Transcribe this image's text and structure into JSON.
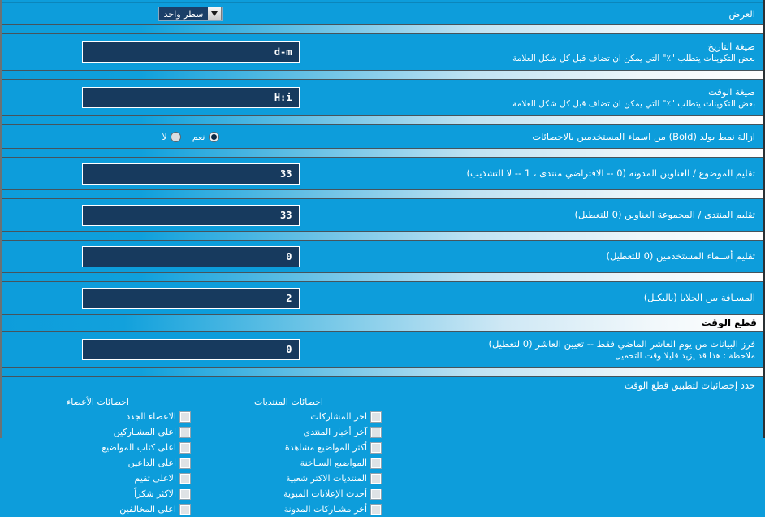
{
  "colors": {
    "background": "#0d9ddb",
    "input_bg": "#173a5e",
    "input_border": "#ffffff",
    "text": "#ffffff",
    "divider_light": "#ffffff",
    "header_text": "#000000"
  },
  "rows": {
    "display": {
      "label": "العرض",
      "select_value": "سطر واحد",
      "arrow_icon": "chevron-down-icon"
    },
    "date_format": {
      "label": "صيغة التاريخ",
      "sub": "بعض التكوينات يتطلب \"٪\" التي يمكن ان تضاف قبل كل شكل العلامة",
      "value": "d-m"
    },
    "time_format": {
      "label": "صيغة الوقت",
      "sub": "بعض التكوينات يتطلب \"٪\" التي يمكن ان تضاف قبل كل شكل العلامة",
      "value": "H:i"
    },
    "remove_bold": {
      "label": "ازالة نمط بولد (Bold) من اسماء المستخدمين بالاحصائات",
      "options": [
        {
          "label": "نعم",
          "selected": true
        },
        {
          "label": "لا",
          "selected": false
        }
      ]
    },
    "trim_topic": {
      "label": "تقليم الموضوع / العناوين المدونة (0 -- الافتراضي منتدى ، 1 -- لا التشذيب)",
      "value": "33"
    },
    "trim_forum": {
      "label": "تقليم المنتدى / المجموعة العناوين (0 للتعطيل)",
      "value": "33"
    },
    "trim_users": {
      "label": "تقليم أسـماء المستخدمين (0 للتعطيل)",
      "value": "0"
    },
    "cell_spacing": {
      "label": "المسـافة بين الخلايا (بالبكـل)",
      "value": "2"
    }
  },
  "section_timecut": {
    "title": "قطع الوقت",
    "sort_row": {
      "label": "فرز البيانات من يوم العاشر الماضي فقط -- تعيين العاشر (0 لتعطيل)",
      "sub": "ملاحظة : هذا قد يزيد قليلا وقت التحميل",
      "value": "0"
    },
    "select_stats_label": "حدد إحصائيات لتطبيق قطع الوقت",
    "columns": [
      {
        "header": "احصائات المنتديات",
        "items": [
          {
            "label": "اخر المشاركات",
            "checked": false
          },
          {
            "label": "آخر أخبار المنتدى",
            "checked": false
          },
          {
            "label": "أكثر المواضيع مشاهدة",
            "checked": false
          },
          {
            "label": "المواضيع السـاخنة",
            "checked": false
          },
          {
            "label": "المنتديات الاكثر شعبية",
            "checked": false
          },
          {
            "label": "أحدث الإعلانات المبوية",
            "checked": false
          },
          {
            "label": "أخر مشـاركات المدونة",
            "checked": false
          }
        ]
      },
      {
        "header": "احصائات الأعضاء",
        "items": [
          {
            "label": "الاعضاء الجدد",
            "checked": false
          },
          {
            "label": "اعلى المشـاركين",
            "checked": false
          },
          {
            "label": "اعلى كتاب المواضيع",
            "checked": false
          },
          {
            "label": "اعلى الداعين",
            "checked": false
          },
          {
            "label": "الاعلى تقيم",
            "checked": false
          },
          {
            "label": "الاكثر شكراً",
            "checked": false
          },
          {
            "label": "اعلى المخالفين",
            "checked": false
          }
        ]
      }
    ]
  }
}
